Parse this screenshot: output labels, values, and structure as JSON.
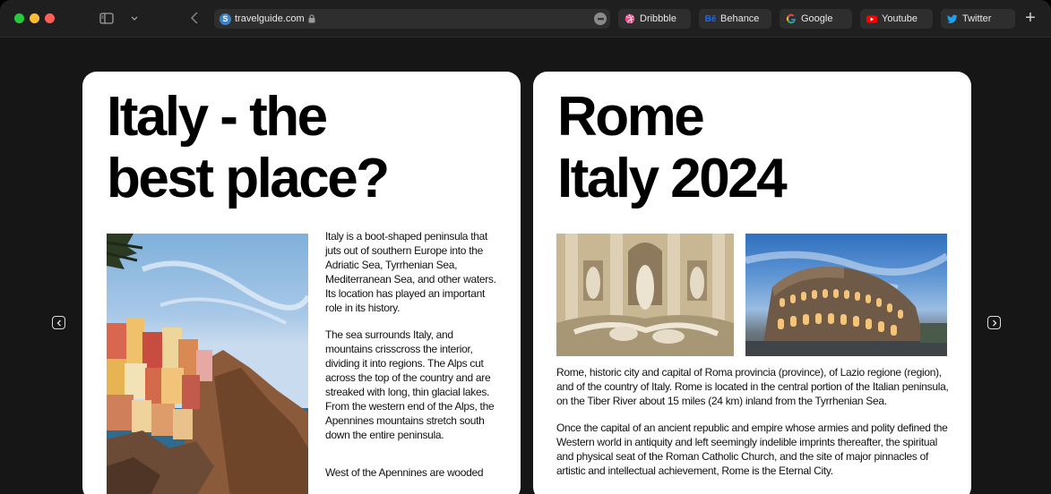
{
  "browser": {
    "url": "travelguide.com",
    "bookmarks": [
      {
        "label": "Dribbble",
        "icon": "dribbble-icon",
        "color": "#ea4c89"
      },
      {
        "label": "Behance",
        "icon": "behance-icon",
        "color": "#1769ff"
      },
      {
        "label": "Google",
        "icon": "google-icon",
        "color": "#4285f4"
      },
      {
        "label": "Youtube",
        "icon": "youtube-icon",
        "color": "#ff0000"
      },
      {
        "label": "Twitter",
        "icon": "twitter-icon",
        "color": "#1da1f2"
      }
    ],
    "new_tab_label": "+"
  },
  "book": {
    "left_page": {
      "title": "Italy - the\nbest place?",
      "image": "cinque-terre-photo",
      "paragraphs": [
        "Italy is a boot-shaped peninsula that juts out of southern Europe into the Adriatic Sea, Tyrrhenian Sea, Mediterranean Sea, and other waters. Its location has played an important role in its history.",
        "The sea surrounds Italy, and mountains crisscross the interior, dividing it into regions. The Alps cut across the top of the country and are streaked with long, thin glacial lakes. From the western end of the Alps, the Apennines mountains stretch south down the entire peninsula.",
        "West of the Apennines are wooded"
      ]
    },
    "right_page": {
      "title": "Rome\nItaly 2024",
      "images": [
        "trevi-fountain-photo",
        "colosseum-photo"
      ],
      "paragraphs": [
        "Rome, historic city and capital of Roma provincia (province), of Lazio regione (region), and of the country of Italy. Rome is located in the central portion of the Italian peninsula, on the Tiber River about 15 miles (24 km) inland from the Tyrrhenian Sea.",
        "Once the capital of an ancient republic and empire whose armies and polity defined the Western world in antiquity and left seemingly indelible imprints thereafter, the spiritual and physical seat of the Roman Catholic Church, and the site of major pinnacles of artistic and intellectual achievement, Rome is the Eternal City."
      ]
    }
  }
}
